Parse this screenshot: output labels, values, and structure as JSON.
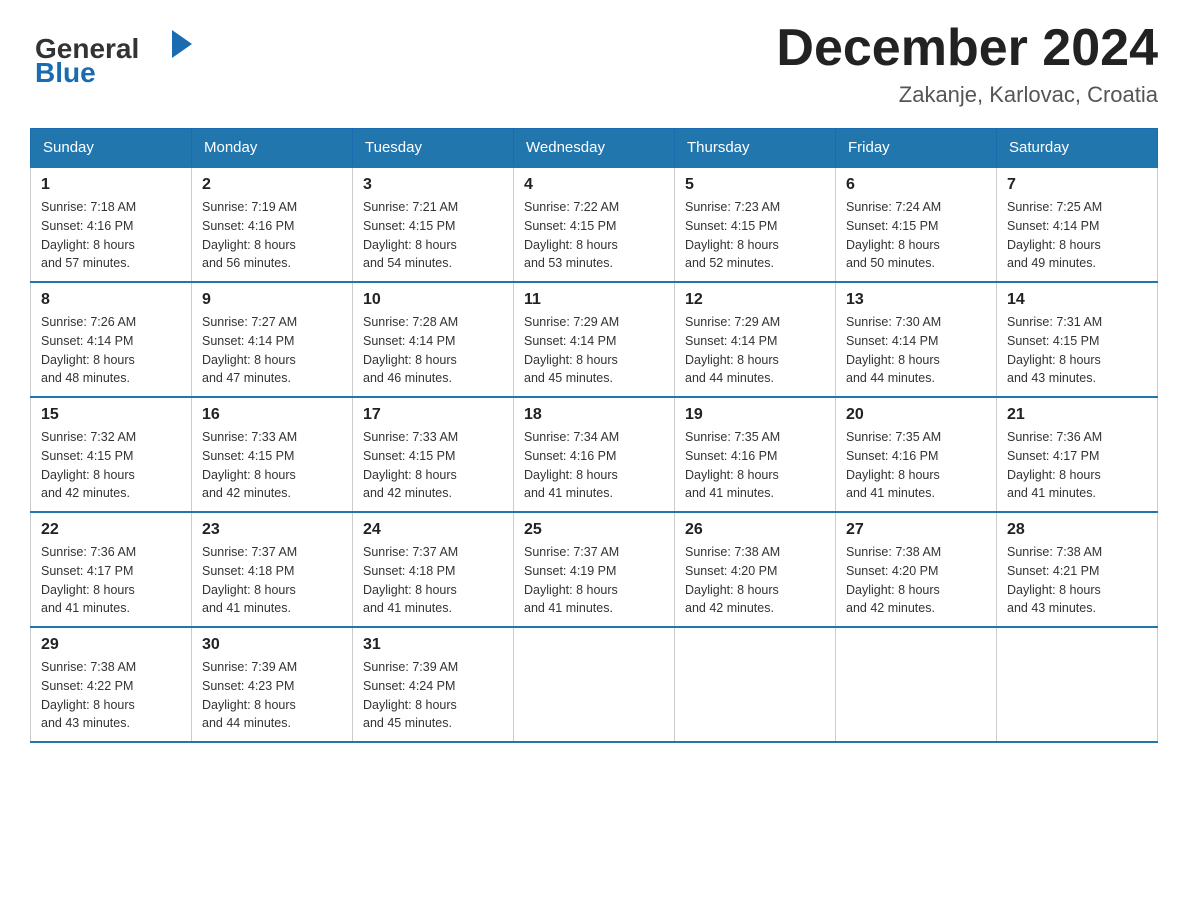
{
  "header": {
    "logo_general": "General",
    "logo_blue": "Blue",
    "month_title": "December 2024",
    "location": "Zakanje, Karlovac, Croatia"
  },
  "weekdays": [
    "Sunday",
    "Monday",
    "Tuesday",
    "Wednesday",
    "Thursday",
    "Friday",
    "Saturday"
  ],
  "weeks": [
    [
      {
        "day": "1",
        "sunrise": "7:18 AM",
        "sunset": "4:16 PM",
        "daylight": "8 hours and 57 minutes."
      },
      {
        "day": "2",
        "sunrise": "7:19 AM",
        "sunset": "4:16 PM",
        "daylight": "8 hours and 56 minutes."
      },
      {
        "day": "3",
        "sunrise": "7:21 AM",
        "sunset": "4:15 PM",
        "daylight": "8 hours and 54 minutes."
      },
      {
        "day": "4",
        "sunrise": "7:22 AM",
        "sunset": "4:15 PM",
        "daylight": "8 hours and 53 minutes."
      },
      {
        "day": "5",
        "sunrise": "7:23 AM",
        "sunset": "4:15 PM",
        "daylight": "8 hours and 52 minutes."
      },
      {
        "day": "6",
        "sunrise": "7:24 AM",
        "sunset": "4:15 PM",
        "daylight": "8 hours and 50 minutes."
      },
      {
        "day": "7",
        "sunrise": "7:25 AM",
        "sunset": "4:14 PM",
        "daylight": "8 hours and 49 minutes."
      }
    ],
    [
      {
        "day": "8",
        "sunrise": "7:26 AM",
        "sunset": "4:14 PM",
        "daylight": "8 hours and 48 minutes."
      },
      {
        "day": "9",
        "sunrise": "7:27 AM",
        "sunset": "4:14 PM",
        "daylight": "8 hours and 47 minutes."
      },
      {
        "day": "10",
        "sunrise": "7:28 AM",
        "sunset": "4:14 PM",
        "daylight": "8 hours and 46 minutes."
      },
      {
        "day": "11",
        "sunrise": "7:29 AM",
        "sunset": "4:14 PM",
        "daylight": "8 hours and 45 minutes."
      },
      {
        "day": "12",
        "sunrise": "7:29 AM",
        "sunset": "4:14 PM",
        "daylight": "8 hours and 44 minutes."
      },
      {
        "day": "13",
        "sunrise": "7:30 AM",
        "sunset": "4:14 PM",
        "daylight": "8 hours and 44 minutes."
      },
      {
        "day": "14",
        "sunrise": "7:31 AM",
        "sunset": "4:15 PM",
        "daylight": "8 hours and 43 minutes."
      }
    ],
    [
      {
        "day": "15",
        "sunrise": "7:32 AM",
        "sunset": "4:15 PM",
        "daylight": "8 hours and 42 minutes."
      },
      {
        "day": "16",
        "sunrise": "7:33 AM",
        "sunset": "4:15 PM",
        "daylight": "8 hours and 42 minutes."
      },
      {
        "day": "17",
        "sunrise": "7:33 AM",
        "sunset": "4:15 PM",
        "daylight": "8 hours and 42 minutes."
      },
      {
        "day": "18",
        "sunrise": "7:34 AM",
        "sunset": "4:16 PM",
        "daylight": "8 hours and 41 minutes."
      },
      {
        "day": "19",
        "sunrise": "7:35 AM",
        "sunset": "4:16 PM",
        "daylight": "8 hours and 41 minutes."
      },
      {
        "day": "20",
        "sunrise": "7:35 AM",
        "sunset": "4:16 PM",
        "daylight": "8 hours and 41 minutes."
      },
      {
        "day": "21",
        "sunrise": "7:36 AM",
        "sunset": "4:17 PM",
        "daylight": "8 hours and 41 minutes."
      }
    ],
    [
      {
        "day": "22",
        "sunrise": "7:36 AM",
        "sunset": "4:17 PM",
        "daylight": "8 hours and 41 minutes."
      },
      {
        "day": "23",
        "sunrise": "7:37 AM",
        "sunset": "4:18 PM",
        "daylight": "8 hours and 41 minutes."
      },
      {
        "day": "24",
        "sunrise": "7:37 AM",
        "sunset": "4:18 PM",
        "daylight": "8 hours and 41 minutes."
      },
      {
        "day": "25",
        "sunrise": "7:37 AM",
        "sunset": "4:19 PM",
        "daylight": "8 hours and 41 minutes."
      },
      {
        "day": "26",
        "sunrise": "7:38 AM",
        "sunset": "4:20 PM",
        "daylight": "8 hours and 42 minutes."
      },
      {
        "day": "27",
        "sunrise": "7:38 AM",
        "sunset": "4:20 PM",
        "daylight": "8 hours and 42 minutes."
      },
      {
        "day": "28",
        "sunrise": "7:38 AM",
        "sunset": "4:21 PM",
        "daylight": "8 hours and 43 minutes."
      }
    ],
    [
      {
        "day": "29",
        "sunrise": "7:38 AM",
        "sunset": "4:22 PM",
        "daylight": "8 hours and 43 minutes."
      },
      {
        "day": "30",
        "sunrise": "7:39 AM",
        "sunset": "4:23 PM",
        "daylight": "8 hours and 44 minutes."
      },
      {
        "day": "31",
        "sunrise": "7:39 AM",
        "sunset": "4:24 PM",
        "daylight": "8 hours and 45 minutes."
      },
      null,
      null,
      null,
      null
    ]
  ],
  "labels": {
    "sunrise": "Sunrise:",
    "sunset": "Sunset:",
    "daylight": "Daylight:"
  }
}
